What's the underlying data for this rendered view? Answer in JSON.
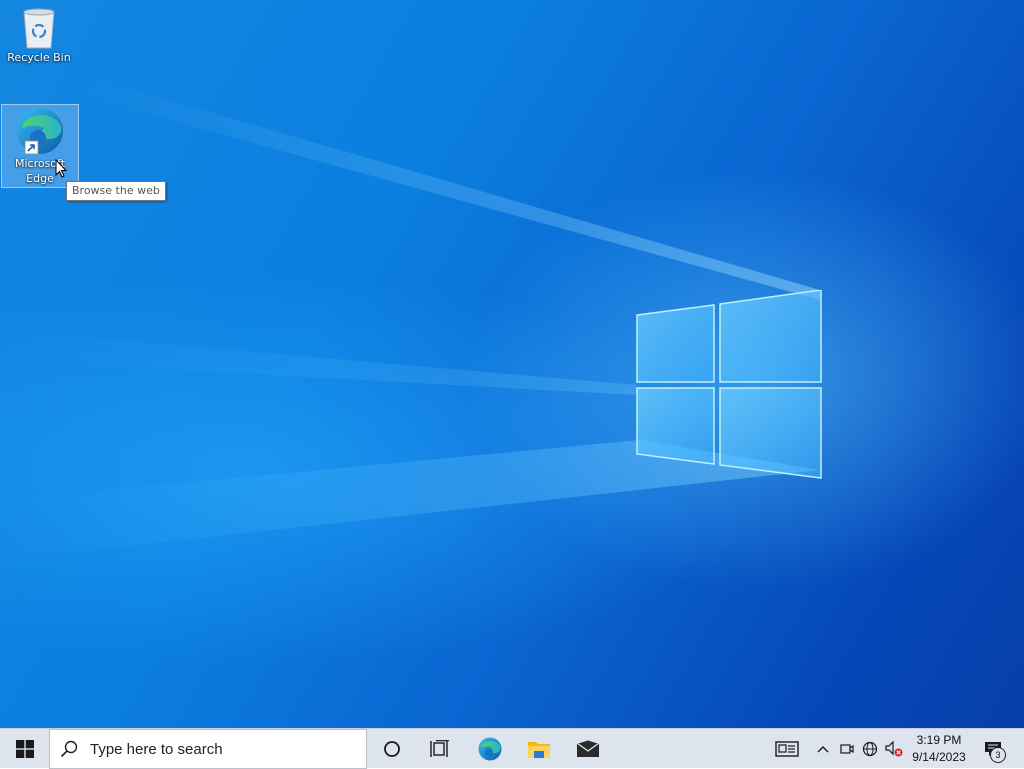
{
  "desktop": {
    "icons": [
      {
        "label": "Recycle Bin",
        "icon": "recycle-bin-icon"
      },
      {
        "label": "Microsoft Edge",
        "icon": "edge-icon",
        "selected": true
      }
    ],
    "tooltip": "Browse the web"
  },
  "taskbar": {
    "start_icon": "windows-start-icon",
    "search_placeholder": "Type here to search",
    "pinned": [
      "cortana-icon",
      "task-view-icon",
      "edge-icon",
      "file-explorer-icon",
      "mail-icon"
    ],
    "tray_icons": [
      "news-widget-icon",
      "chevron-up-icon",
      "meet-now-icon",
      "network-icon",
      "volume-muted-icon"
    ],
    "clock": {
      "time": "3:19 PM",
      "date": "9/14/2023"
    },
    "notifications_count": "3"
  },
  "colors": {
    "taskbar_bg": "#dde4ee",
    "desktop_accent": "#0b7fe0"
  }
}
